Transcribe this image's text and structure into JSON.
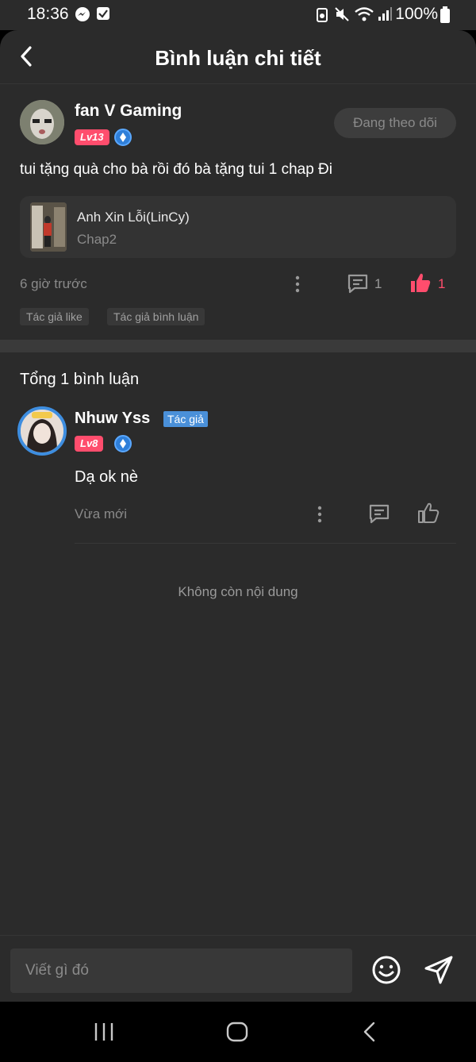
{
  "status_bar": {
    "time": "18:36",
    "battery": "100%",
    "icons": [
      "messenger-icon",
      "check-box-icon",
      "battery-saver-icon",
      "mute-icon",
      "wifi-icon",
      "signal-icon",
      "battery-icon"
    ]
  },
  "header": {
    "title": "Bình luận chi tiết"
  },
  "post": {
    "author": "fan V Gaming",
    "level": "Lv13",
    "follow_label": "Đang theo dõi",
    "text": "tui tặng quà cho bà rồi đó bà tặng tui 1 chap Đi",
    "chapter_card": {
      "title": "Anh Xin Lỗi(LinCy)",
      "subtitle": "Chap2"
    },
    "time": "6 giờ trước",
    "comment_count": "1",
    "like_count": "1",
    "tags": [
      "Tác giả like",
      "Tác giả bình luận"
    ]
  },
  "comments": {
    "total_label": "Tổng 1 bình luận",
    "items": [
      {
        "author": "Nhuw Yss",
        "author_badge": "Tác giả",
        "level": "Lv8",
        "text": "Dạ ok nè",
        "time": "Vừa mới"
      }
    ],
    "end_label": "Không còn nội dung"
  },
  "composer": {
    "placeholder": "Viết gì đó"
  },
  "colors": {
    "background": "#2b2b2b",
    "accent_like": "#ff4d6d",
    "author_badge": "#4a90d9"
  }
}
